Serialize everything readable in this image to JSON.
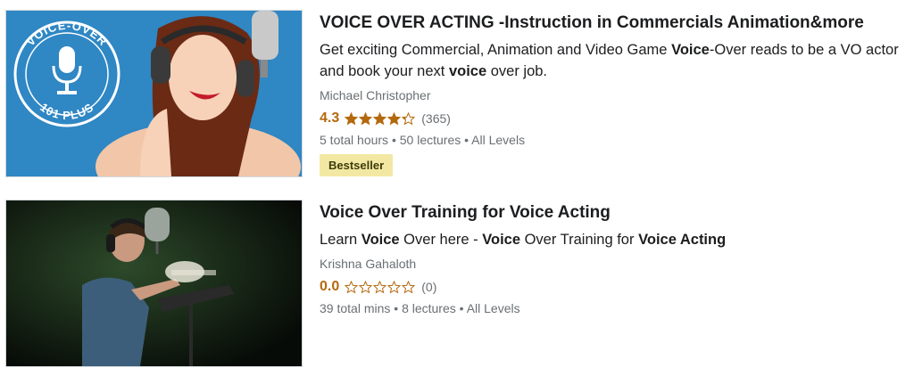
{
  "courses": [
    {
      "title": "VOICE OVER ACTING -Instruction in Commercials Animation&more",
      "headline": {
        "p1": "Get exciting Commercial, Animation and Video Game ",
        "b1": "Voice",
        "p2": "-Over reads to be a VO actor and book your next ",
        "b2": "voice",
        "p3": " over job."
      },
      "instructor": "Michael Christopher",
      "rating": "4.3",
      "rating_value": 4.3,
      "rating_count": "(365)",
      "hours": "5 total hours",
      "lectures": "50 lectures",
      "level": "All Levels",
      "badge": "Bestseller",
      "thumb_logo_top": "VOICE-OVER",
      "thumb_logo_bottom": "101 PLUS",
      "thumb_icon": "microphone-icon"
    },
    {
      "title": "Voice Over Training for Voice Acting",
      "headline": {
        "p1": "Learn ",
        "b1": "Voice",
        "p2": " Over here - ",
        "b2": "Voice",
        "p3": " Over Training for ",
        "b3": "Voice Acting"
      },
      "instructor": "Krishna Gahaloth",
      "rating": "0.0",
      "rating_value": 0,
      "rating_count": "(0)",
      "hours": "39 total mins",
      "lectures": "8 lectures",
      "level": "All Levels"
    }
  ],
  "separator": "•",
  "colors": {
    "rating": "#b4690e",
    "badge_bg": "#f3e8a3",
    "thumb1_bg": "#2f87c4"
  }
}
